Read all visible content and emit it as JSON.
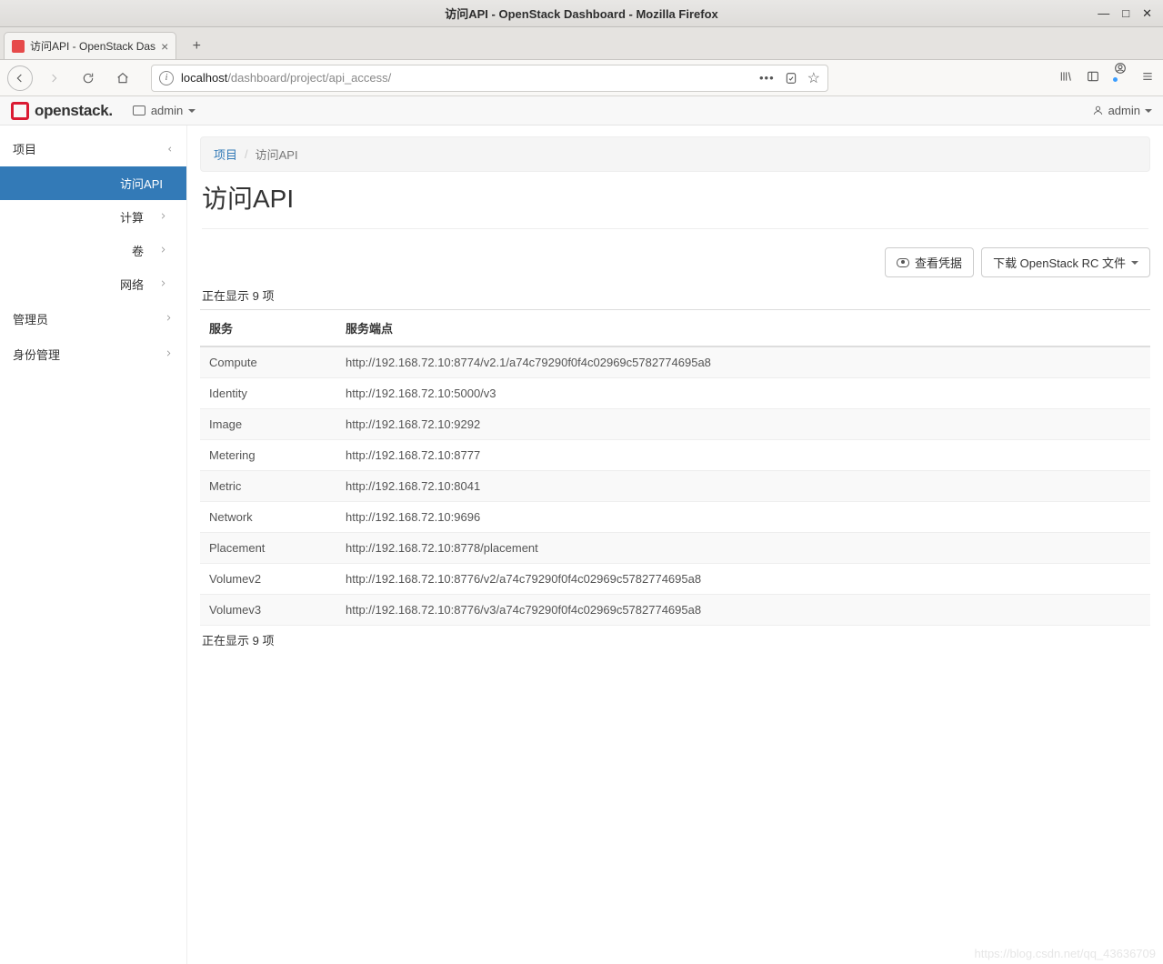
{
  "window": {
    "title": "访问API - OpenStack Dashboard - Mozilla Firefox"
  },
  "browser": {
    "tab_title": "访问API - OpenStack Das",
    "url_prefix": "localhost",
    "url_path": "/dashboard/project/api_access/"
  },
  "topbar": {
    "brand": "openstack.",
    "project_label": "admin",
    "user_label": "admin"
  },
  "sidebar": {
    "project": {
      "label": "项目"
    },
    "api_access": {
      "label": "访问API"
    },
    "compute": {
      "label": "计算"
    },
    "volume": {
      "label": "卷"
    },
    "network": {
      "label": "网络"
    },
    "admin": {
      "label": "管理员"
    },
    "identity": {
      "label": "身份管理"
    }
  },
  "breadcrumbs": {
    "root": "项目",
    "current": "访问API"
  },
  "page": {
    "title": "访问API",
    "view_credentials": "查看凭据",
    "download_rc": "下载 OpenStack RC 文件",
    "count_top": "正在显示 9 项",
    "count_bottom": "正在显示 9 项"
  },
  "table": {
    "headers": {
      "service": "服务",
      "endpoint": "服务端点"
    },
    "rows": [
      {
        "service": "Compute",
        "endpoint": "http://192.168.72.10:8774/v2.1/a74c79290f0f4c02969c5782774695a8"
      },
      {
        "service": "Identity",
        "endpoint": "http://192.168.72.10:5000/v3"
      },
      {
        "service": "Image",
        "endpoint": "http://192.168.72.10:9292"
      },
      {
        "service": "Metering",
        "endpoint": "http://192.168.72.10:8777"
      },
      {
        "service": "Metric",
        "endpoint": "http://192.168.72.10:8041"
      },
      {
        "service": "Network",
        "endpoint": "http://192.168.72.10:9696"
      },
      {
        "service": "Placement",
        "endpoint": "http://192.168.72.10:8778/placement"
      },
      {
        "service": "Volumev2",
        "endpoint": "http://192.168.72.10:8776/v2/a74c79290f0f4c02969c5782774695a8"
      },
      {
        "service": "Volumev3",
        "endpoint": "http://192.168.72.10:8776/v3/a74c79290f0f4c02969c5782774695a8"
      }
    ]
  },
  "watermark": "https://blog.csdn.net/qq_43636709"
}
